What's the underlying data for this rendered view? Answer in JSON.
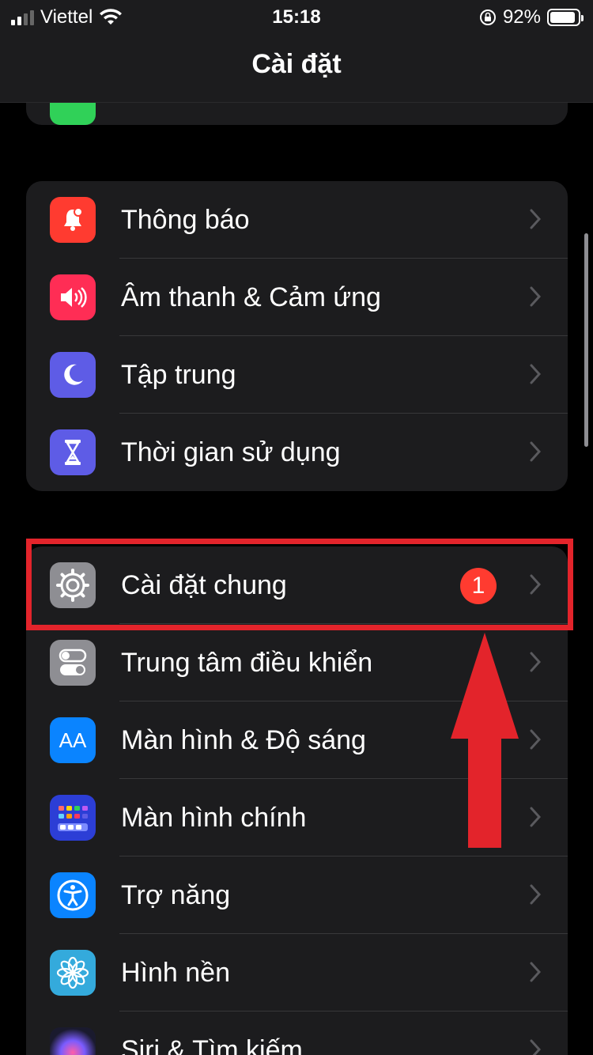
{
  "status_bar": {
    "carrier": "Viettel",
    "time": "15:18",
    "battery_percent": "92%",
    "battery_level": 0.92,
    "signal_bars": 4,
    "signal_bars_active": 2,
    "icons": [
      "signal-icon",
      "wifi-icon",
      "orientation-lock-icon",
      "battery-icon"
    ]
  },
  "nav": {
    "title": "Cài đặt"
  },
  "groups": [
    {
      "items": [
        {
          "label": "Thông báo",
          "icon": "bell-icon",
          "color": "#ff3b30"
        },
        {
          "label": "Âm thanh & Cảm ứng",
          "icon": "speaker-icon",
          "color": "#ff2d55"
        },
        {
          "label": "Tập trung",
          "icon": "moon-icon",
          "color": "#5e5ce6"
        },
        {
          "label": "Thời gian sử dụng",
          "icon": "hourglass-icon",
          "color": "#5e5ce6"
        }
      ]
    },
    {
      "items": [
        {
          "label": "Cài đặt chung",
          "icon": "gear-icon",
          "color": "#8e8e93",
          "badge": "1"
        },
        {
          "label": "Trung tâm điều khiển",
          "icon": "toggles-icon",
          "color": "#8e8e93"
        },
        {
          "label": "Màn hình & Độ sáng",
          "icon": "text-size-icon",
          "color": "#0a84ff",
          "icon_text": "AA"
        },
        {
          "label": "Màn hình chính",
          "icon": "home-grid-icon",
          "color": "#2c3ed6"
        },
        {
          "label": "Trợ năng",
          "icon": "accessibility-icon",
          "color": "#0a84ff"
        },
        {
          "label": "Hình nền",
          "icon": "flower-icon",
          "color": "#34aadc"
        },
        {
          "label": "Siri & Tìm kiếm",
          "icon": "siri-icon",
          "color": "#222"
        }
      ]
    }
  ],
  "colors": {
    "background": "#000000",
    "cell": "#1c1c1e",
    "separator": "#38383a",
    "highlight": "#e3242b",
    "chevron": "#5a5a5e"
  }
}
